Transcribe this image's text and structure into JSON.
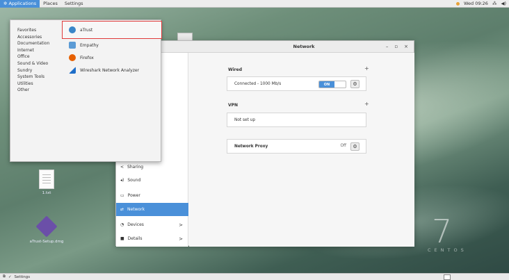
{
  "topbar": {
    "applications": "Applications",
    "places": "Places",
    "settings": "Settings",
    "clock": "Wed 09:26"
  },
  "app_menu": {
    "categories": [
      "Favorites",
      "Accessories",
      "Documentation",
      "Internet",
      "Office",
      "Sound & Video",
      "Sundry",
      "System Tools",
      "Utilities",
      "Other"
    ],
    "apps": [
      {
        "label": "aTrust",
        "icon": "atrust-icon",
        "color": "#3a86c8"
      },
      {
        "label": "Empathy",
        "icon": "empathy-icon",
        "color": "#5b9bd5"
      },
      {
        "label": "Firefox",
        "icon": "firefox-icon",
        "color": "#e66000"
      },
      {
        "label": "Wireshark Network Analyzer",
        "icon": "wireshark-icon",
        "color": "#1e6ec8"
      }
    ]
  },
  "settings_window": {
    "title": "Network",
    "sidebar": [
      {
        "label": "Sharing",
        "icon": "share-icon"
      },
      {
        "label": "Sound",
        "icon": "sound-icon"
      },
      {
        "label": "Power",
        "icon": "power-icon"
      },
      {
        "label": "Network",
        "icon": "network-icon",
        "active": true
      },
      {
        "label": "Devices",
        "icon": "devices-icon",
        "chevron": ">"
      },
      {
        "label": "Details",
        "icon": "details-icon",
        "chevron": ">"
      }
    ],
    "wired": {
      "title": "Wired",
      "status": "Connected - 1000 Mb/s",
      "toggle": "ON"
    },
    "vpn": {
      "title": "VPN",
      "status": "Not set up"
    },
    "proxy": {
      "title": "Network Proxy",
      "state": "Off"
    }
  },
  "desktop": {
    "icons": [
      {
        "label": "1.txt"
      },
      {
        "label": "aTrust-Setup.dmg"
      }
    ],
    "brand_number": "7",
    "brand_word": "CENTOS"
  },
  "taskbar": {
    "task_label": "Settings"
  },
  "colors": {
    "accent": "#4a90d9",
    "highlight": "#e03a3a"
  }
}
